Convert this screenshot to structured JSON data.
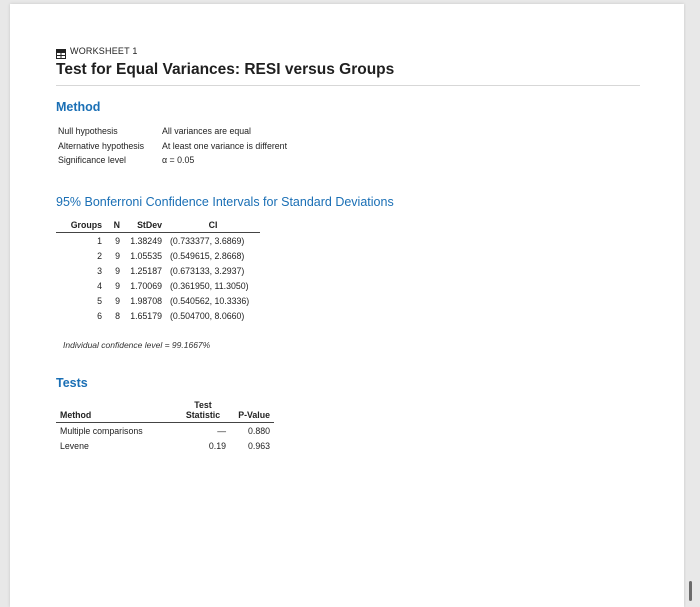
{
  "worksheet": {
    "label": "WORKSHEET 1",
    "icon": "grid-icon"
  },
  "title": "Test for Equal Variances: RESI versus Groups",
  "method": {
    "heading": "Method",
    "rows": [
      {
        "key": "Null hypothesis",
        "value": "All variances are equal"
      },
      {
        "key": "Alternative hypothesis",
        "value": "At least one variance is different"
      },
      {
        "key": "Significance level",
        "value": "α = 0.05"
      }
    ]
  },
  "ci_section": {
    "heading": "95% Bonferroni Confidence Intervals for Standard Deviations",
    "columns": [
      "Groups",
      "N",
      "StDev",
      "CI"
    ],
    "rows": [
      [
        "1",
        "9",
        "1.38249",
        "(0.733377, 3.6869)"
      ],
      [
        "2",
        "9",
        "1.05535",
        "(0.549615, 2.8668)"
      ],
      [
        "3",
        "9",
        "1.25187",
        "(0.673133, 3.2937)"
      ],
      [
        "4",
        "9",
        "1.70069",
        "(0.361950, 11.3050)"
      ],
      [
        "5",
        "9",
        "1.98708",
        "(0.540562, 10.3336)"
      ],
      [
        "6",
        "8",
        "1.65179",
        "(0.504700, 8.0660)"
      ]
    ],
    "note": "Individual confidence level = 99.1667%"
  },
  "tests": {
    "heading": "Tests",
    "columns": {
      "method": "Method",
      "stat_top": "Test",
      "stat_bottom": "Statistic",
      "pvalue": "P-Value"
    },
    "rows": [
      [
        "Multiple comparisons",
        "—",
        "0.880"
      ],
      [
        "Levene",
        "0.19",
        "0.963"
      ]
    ]
  },
  "colors": {
    "heading_blue": "#1a6fb5",
    "page_bg": "#ffffff",
    "frame_bg": "#e8e8e8"
  }
}
